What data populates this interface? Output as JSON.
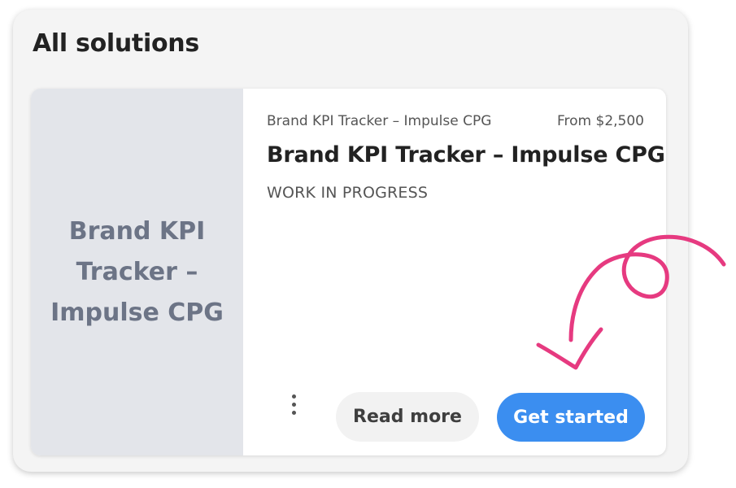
{
  "section": {
    "title": "All solutions"
  },
  "card": {
    "thumbnail_text": "Brand KPI Tracker – Impulse CPG",
    "meta_name": "Brand KPI Tracker – Impulse CPG",
    "price": "From $2,500",
    "title": "Brand KPI Tracker – Impulse CPG",
    "status": "WORK IN PROGRESS",
    "more_icon": "vertical-ellipsis-icon",
    "read_more_label": "Read more",
    "get_started_label": "Get started"
  },
  "colors": {
    "primary_button": "#3b8ef0",
    "annotation_arrow": "#e63a80"
  }
}
